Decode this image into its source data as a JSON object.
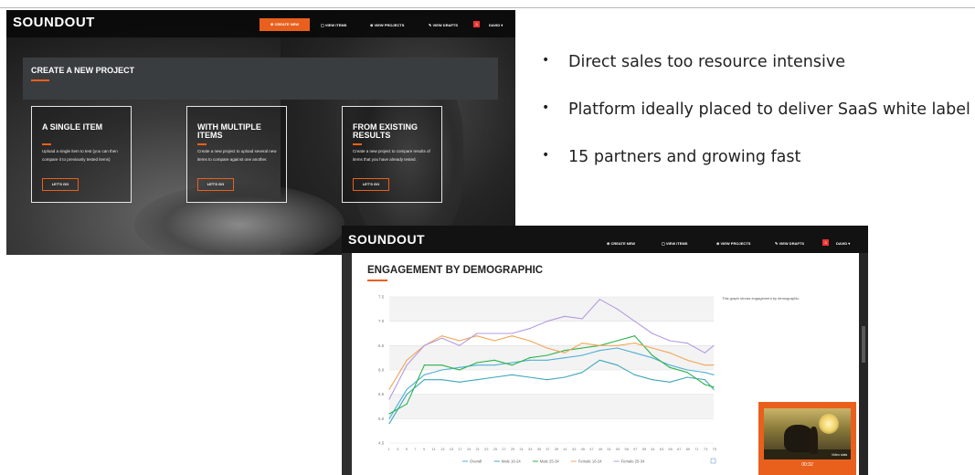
{
  "top_window": {
    "app_logo": "SOUNDOUT",
    "nav": {
      "create_button": "CREATE NEW",
      "view_items": "VIEW ITEMS",
      "view_projects": "VIEW PROJECTS",
      "view_drafts": "VIEW DRAFTS",
      "notification_count": "3",
      "user_menu": "DAVID ▾"
    },
    "panel_title": "CREATE A NEW PROJECT",
    "cards": [
      {
        "title": "A SINGLE ITEM",
        "description": "Upload a single item to test (you can then compare it to previously tested items)",
        "button": "LET'S GO"
      },
      {
        "title": "WITH MULTIPLE ITEMS",
        "description": "Create a new project to upload several new items to compare against one another.",
        "button": "LET'S GO"
      },
      {
        "title": "FROM EXISTING RESULTS",
        "description": "Create a new project to compare results of items that you have already tested.",
        "button": "LET'S GO"
      }
    ]
  },
  "bullets": [
    "Direct sales too resource intensive",
    "Platform ideally placed to deliver SaaS white label",
    "15 partners and growing fast"
  ],
  "bottom_window": {
    "app_logo": "SOUNDOUT",
    "nav": {
      "create_new": "CREATE NEW",
      "view_items": "VIEW ITEMS",
      "view_projects": "VIEW PROJECTS",
      "view_drafts": "VIEW DRAFTS",
      "notification_count": "3",
      "user_menu": "DAVID ▾"
    },
    "section_title": "ENGAGEMENT BY DEMOGRAPHIC",
    "chart_note": "This graph shows engagement by demographic.",
    "video": {
      "duration": "00:32",
      "label": "Video stats"
    }
  },
  "colors": {
    "accent": "#e8601c",
    "overall": "#4fb0d6",
    "male_16_24": "#3fa7b9",
    "male_25_34": "#2cb34a",
    "female_16_24": "#f2a65a",
    "female_25_34": "#b49be0"
  },
  "chart_data": {
    "type": "line",
    "title": "",
    "xlabel": "",
    "ylabel": "",
    "ylim": [
      4.5,
      7.5
    ],
    "yticks": [
      "4.5",
      "5.0",
      "5.5",
      "6.0",
      "6.5",
      "7.0",
      "7.5"
    ],
    "xticks": [
      "1",
      "3",
      "5",
      "7",
      "9",
      "11",
      "13",
      "15",
      "17",
      "19",
      "21",
      "23",
      "25",
      "27",
      "29",
      "31",
      "33",
      "35",
      "37",
      "39",
      "41",
      "43",
      "45",
      "47",
      "49",
      "51",
      "53",
      "55",
      "57",
      "59",
      "61",
      "63",
      "65",
      "67",
      "69",
      "71",
      "73",
      "75"
    ],
    "x": [
      1,
      5,
      9,
      13,
      17,
      21,
      25,
      29,
      33,
      37,
      41,
      45,
      49,
      53,
      57,
      61,
      65,
      69,
      73,
      75
    ],
    "legend_position": "bottom",
    "series": [
      {
        "name": "Overall",
        "color": "#4fb0d6",
        "values": [
          5.0,
          5.6,
          5.9,
          6.0,
          6.05,
          6.1,
          6.1,
          6.15,
          6.2,
          6.2,
          6.25,
          6.3,
          6.4,
          6.45,
          6.35,
          6.25,
          6.1,
          6.0,
          5.95,
          5.9
        ]
      },
      {
        "name": "Male 16-24",
        "color": "#3fa7b9",
        "values": [
          4.9,
          5.5,
          5.8,
          5.8,
          5.75,
          5.8,
          5.85,
          5.9,
          5.85,
          5.8,
          5.85,
          5.95,
          6.2,
          6.1,
          5.9,
          5.8,
          5.75,
          5.85,
          5.8,
          5.6
        ]
      },
      {
        "name": "Male 25-34",
        "color": "#2cb34a",
        "values": [
          5.1,
          5.3,
          6.1,
          6.1,
          6.0,
          6.15,
          6.2,
          6.1,
          6.25,
          6.3,
          6.4,
          6.45,
          6.5,
          6.6,
          6.7,
          6.3,
          6.05,
          5.95,
          5.7,
          5.65
        ]
      },
      {
        "name": "Female 16-24",
        "color": "#f2a65a",
        "values": [
          5.6,
          6.2,
          6.5,
          6.7,
          6.6,
          6.7,
          6.6,
          6.7,
          6.6,
          6.45,
          6.35,
          6.55,
          6.5,
          6.5,
          6.55,
          6.45,
          6.35,
          6.2,
          6.1,
          6.1
        ]
      },
      {
        "name": "Female 25-34",
        "color": "#b49be0",
        "values": [
          5.4,
          6.1,
          6.5,
          6.65,
          6.5,
          6.75,
          6.75,
          6.75,
          6.85,
          7.0,
          7.1,
          7.05,
          7.45,
          7.25,
          7.0,
          6.75,
          6.6,
          6.55,
          6.35,
          6.5
        ]
      }
    ]
  }
}
